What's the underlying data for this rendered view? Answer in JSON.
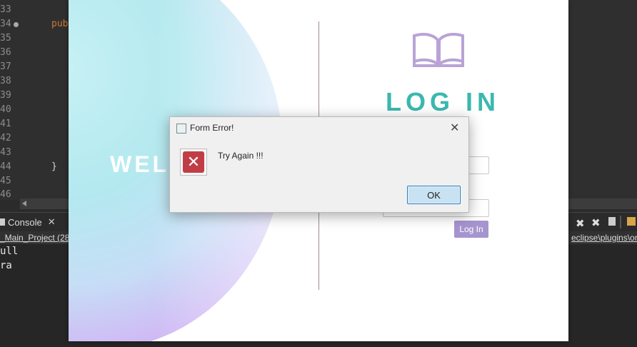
{
  "editor": {
    "line_numbers": [
      "33",
      "34",
      "35",
      "36",
      "37",
      "38",
      "39",
      "40",
      "41",
      "42",
      "43",
      "44",
      "45",
      "46"
    ],
    "line34_code": "pub",
    "line44_code": "}"
  },
  "console": {
    "tab_label": "Console",
    "project_label": "_Main_Project (28)",
    "path_label": "eclipse\\plugins\\or",
    "output_lines": [
      "ull",
      "ra"
    ]
  },
  "login_window": {
    "welcome_text": "WEL",
    "title": "LOG IN",
    "login_button_label": "Log In"
  },
  "dialog": {
    "title": "Form Error!",
    "message": "Try Again !!!",
    "ok_label": "OK",
    "close_glyph": "✕",
    "error_glyph": "✕"
  },
  "icons": {
    "book": "book-icon",
    "error": "error-icon",
    "console": "console-icon"
  },
  "colors": {
    "login_title": "#3bb8ae",
    "book": "#b9a3d6",
    "login_button": "#a694cf",
    "error_icon": "#c13d46",
    "ok_border": "#2b7fbd"
  }
}
